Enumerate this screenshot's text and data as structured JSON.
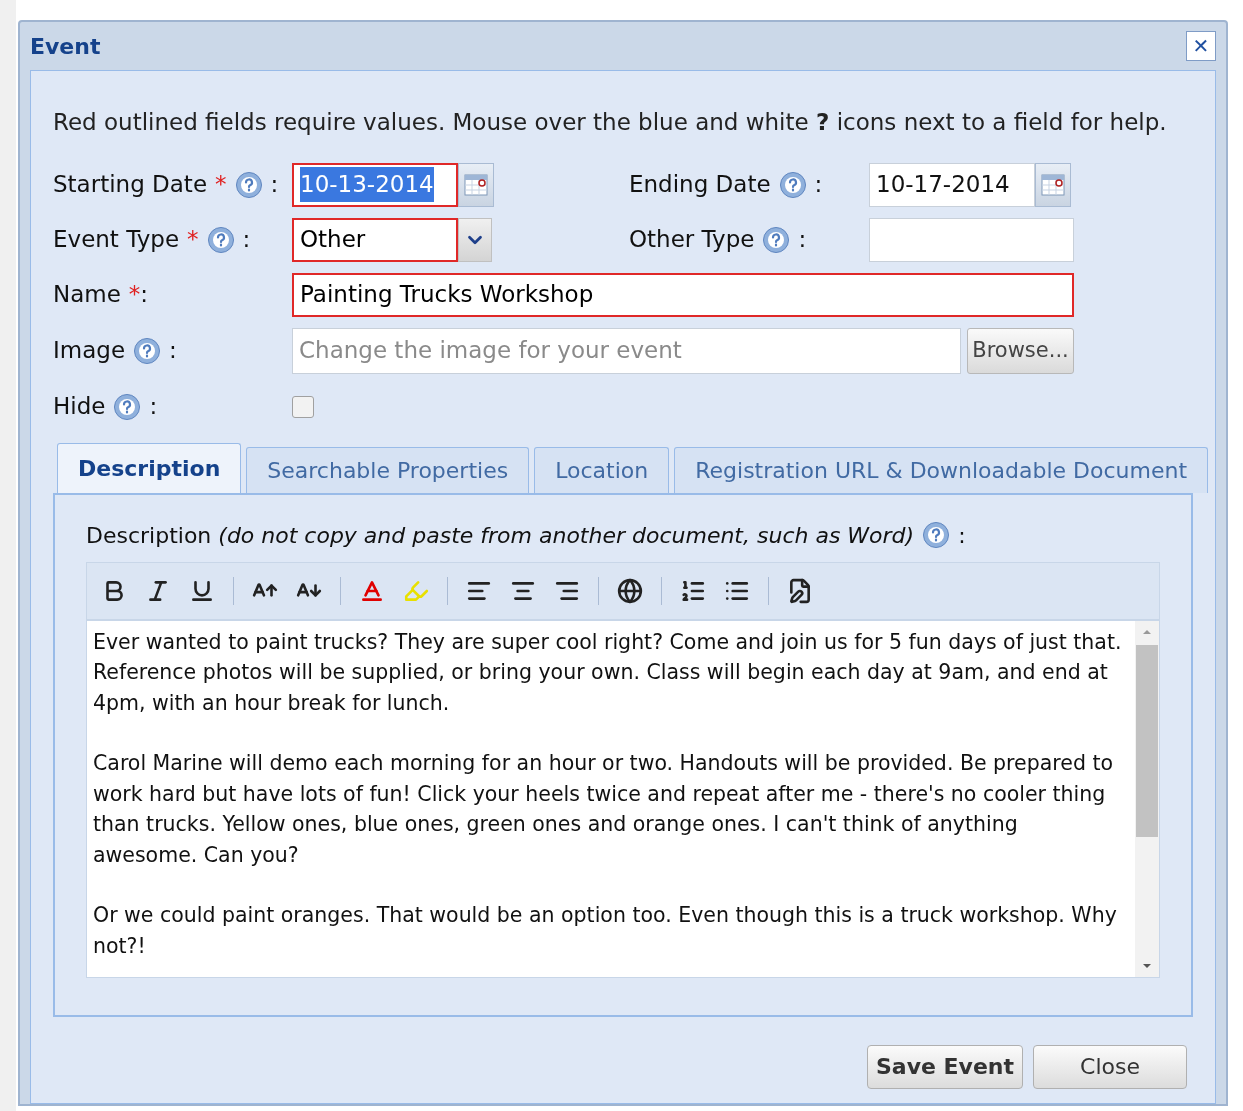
{
  "window": {
    "title": "Event",
    "close_label": "✕"
  },
  "instructions": "Red outlined fields require values. Mouse over the blue and white **?** icons next to a field for help.",
  "fields": {
    "starting_date": {
      "label": "Starting Date",
      "required": true,
      "required_mark": "*",
      "colon": ":",
      "value": "10-13-2014",
      "selected": true
    },
    "ending_date": {
      "label": "Ending Date",
      "required": false,
      "colon": ":",
      "value": "10-17-2014",
      "selected": false
    },
    "event_type": {
      "label": "Event Type",
      "required": true,
      "required_mark": "*",
      "colon": ":",
      "value": "Other"
    },
    "other_type": {
      "label": "Other Type",
      "required": false,
      "colon": ":"
    },
    "name": {
      "label": "Name",
      "required": true,
      "required_mark": "*",
      "colon": ":",
      "value": "Painting Trucks Workshop"
    },
    "image": {
      "label": "Image",
      "colon": ":",
      "placeholder": "Change the image for your event",
      "button": "Browse..."
    },
    "hide": {
      "label": "Hide",
      "colon": ":",
      "checked": false
    }
  },
  "tabs": [
    {
      "label": "Description",
      "selected": true
    },
    {
      "label": "Searchable Properties",
      "selected": false
    },
    {
      "label": "Location",
      "selected": false
    },
    {
      "label": "Registration URL & Downloadable Document",
      "selected": false
    }
  ],
  "description": {
    "label": "Description *(do not copy and paste from another document, such as Word)*",
    "colon": ":",
    "paragraphs": [
      "Ever wanted to paint trucks? They are super cool right? Come and join us for 5 fun days of just that. Reference photos will be supplied, or bring your own. Class will begin each day at 9am, and end at 4pm, with an hour break for lunch.",
      "Carol Marine will demo each morning for an hour or two. Handouts will be provided. Be prepared to work hard but have lots of fun! Click your heels twice and repeat after me - there's no cooler thing than trucks. Yellow ones, blue ones, green ones and orange ones. I can't think of anything awesome. Can you?",
      "Or we could paint oranges. That would be an option too. Even though this is a truck workshop. Why not?!"
    ]
  },
  "buttons": [
    {
      "label": "Save Event",
      "kind": "primary"
    },
    {
      "label": "Close",
      "kind": "secondary"
    }
  ]
}
